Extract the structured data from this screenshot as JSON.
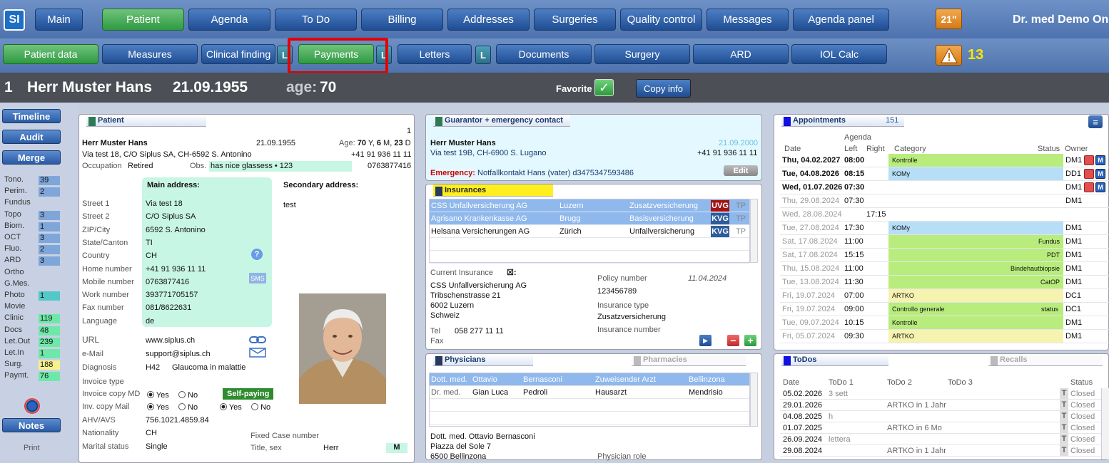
{
  "app": {
    "logo": "SI",
    "doctor": "Dr. med Demo One",
    "screen_size": "21\"",
    "alert_count": "13"
  },
  "nav": {
    "main": "Main",
    "patient": "Patient",
    "agenda": "Agenda",
    "todo": "To Do",
    "billing": "Billing",
    "addresses": "Addresses",
    "surgeries": "Surgeries",
    "quality": "Quality control",
    "messages": "Messages",
    "agenda_panel": "Agenda panel"
  },
  "subnav": {
    "patient_data": "Patient data",
    "measures": "Measures",
    "clinical": "Clinical finding",
    "l": "L",
    "payments": "Payments",
    "letters": "Letters",
    "documents": "Documents",
    "surgery": "Surgery",
    "ard": "ARD",
    "iol": "IOL Calc"
  },
  "header": {
    "index": "1",
    "name": "Herr Muster Hans",
    "dob": "21.09.1955",
    "age_label": "age:",
    "age": "70",
    "favorite": "Favorite",
    "copy_info": "Copy info"
  },
  "sidebar": {
    "timeline": "Timeline",
    "audit": "Audit",
    "merge": "Merge",
    "notes": "Notes",
    "print": "Print",
    "counts": [
      {
        "label": "Tono.",
        "value": "39",
        "color": "#7fa6d8"
      },
      {
        "label": "Perim.",
        "value": "2",
        "color": "#7fa6d8"
      },
      {
        "label": "Fundus",
        "value": "",
        "color": ""
      },
      {
        "label": "Topo",
        "value": "3",
        "color": "#7fa6d8"
      },
      {
        "label": "Biom.",
        "value": "1",
        "color": "#7fa6d8"
      },
      {
        "label": "OCT",
        "value": "3",
        "color": "#7fa6d8"
      },
      {
        "label": "Fluo.",
        "value": "2",
        "color": "#7fa6d8"
      },
      {
        "label": "ARD",
        "value": "3",
        "color": "#7fa6d8"
      },
      {
        "label": "Ortho",
        "value": "",
        "color": ""
      },
      {
        "label": "G.Mes.",
        "value": "",
        "color": ""
      },
      {
        "label": "Photo",
        "value": "1",
        "color": "#54c8c8"
      },
      {
        "label": "Movie",
        "value": "",
        "color": ""
      },
      {
        "label": "Clinic",
        "value": "119",
        "color": "#6ee8a8"
      },
      {
        "label": "Docs",
        "value": "48",
        "color": "#6ee8a8"
      },
      {
        "label": "Let.Out",
        "value": "239",
        "color": "#6ee8a8"
      },
      {
        "label": "Let.In",
        "value": "1",
        "color": "#6ee8a8"
      },
      {
        "label": "Surg.",
        "value": "188",
        "color": "#f6f28a"
      },
      {
        "label": "Paymt.",
        "value": "76",
        "color": "#6ee8a8"
      }
    ]
  },
  "patient": {
    "title": "Patient",
    "page": "1",
    "name": "Herr Muster Hans",
    "dob": "21.09.1955",
    "age_label": "Age:",
    "age_years": "70",
    "age_y": "Y,",
    "age_months": "6",
    "age_m": "M,",
    "age_days": "23",
    "age_d": "D",
    "address_line": "Via test 18, C/O Siplus SA, CH-6592 S. Antonino",
    "phone": "+41 91 936 11 11",
    "occupation_label": "Occupation",
    "occupation": "Retired",
    "obs_label": "Obs.",
    "obs": "has nice glassess • 123",
    "mobile": "0763877416",
    "main_address": "Main address:",
    "secondary_address": "Secondary address:",
    "secondary_value": "test",
    "fields": [
      {
        "label": "Street 1",
        "value": "Via test 18"
      },
      {
        "label": "Street 2",
        "value": "C/O Siplus SA"
      },
      {
        "label": "ZIP/City",
        "value": "6592     S. Antonino"
      },
      {
        "label": "State/Canton",
        "value": "TI"
      },
      {
        "label": "Country",
        "value": "CH"
      },
      {
        "label": "Home number",
        "value": "+41 91 936 11 11"
      },
      {
        "label": "Mobile number",
        "value": "0763877416"
      },
      {
        "label": "Work number",
        "value": "393771705157"
      },
      {
        "label": "Fax number",
        "value": "081/8622631"
      },
      {
        "label": "Language",
        "value": "de"
      }
    ],
    "sms": "SMS",
    "url_label": "URL",
    "url": "www.siplus.ch",
    "email_label": "e-Mail",
    "email": "support@siplus.ch",
    "diagnosis_label": "Diagnosis",
    "diagnosis_code": "H42",
    "diagnosis": "Glaucoma in malattie",
    "invoice_type": "Invoice type",
    "invoice_md": "Invoice copy MD",
    "inv_mail": "Inv. copy Mail",
    "yes": "Yes",
    "no": "No",
    "self_paying": "Self-paying",
    "ahv_label": "AHV/AVS",
    "ahv": "756.1021.4859.84",
    "nationality_label": "Nationality",
    "nationality": "CH",
    "marital_label": "Marital status",
    "marital": "Single",
    "fixed_case": "Fixed Case number",
    "title_sex_label": "Title, sex",
    "title_sex": "Herr",
    "sex_code": "M"
  },
  "guarantor": {
    "title": "Guarantor + emergency contact",
    "name": "Herr Muster Hans",
    "date": "21.09.2000",
    "address": "Via test 19B, CH-6900 S. Lugano",
    "phone": "+41 91 936 11 11",
    "emergency_label": "Emergency:",
    "emergency": "Notfallkontakt Hans (vater) d3475347593486",
    "edit": "Edit"
  },
  "insurances": {
    "title": "Insurances",
    "rows": [
      {
        "name": "CSS Unfallversicherung AG",
        "city": "Luzern",
        "type": "Zusatzversicherung",
        "code": "UVG",
        "tp": "TP",
        "selected": true,
        "code_color": "#a31414"
      },
      {
        "name": "Agrisano Krankenkasse AG",
        "city": "Brugg",
        "type": "Basisversicherung",
        "code": "KVG",
        "tp": "TP",
        "selected": true,
        "code_color": "#2e5c9a"
      },
      {
        "name": "Helsana Versicherungen AG",
        "city": "Zürich",
        "type": "Unfallversicherung",
        "code": "KVG",
        "tp": "TP",
        "selected": false,
        "code_color": "#2e5c9a"
      }
    ],
    "current_label": "Current Insurance",
    "current_name": "CSS Unfallversicherung AG",
    "current_street": "Tribschenstrasse 21",
    "current_city": "6002 Luzern",
    "current_country": "Schweiz",
    "tel_label": "Tel",
    "tel": "058 277 11 11",
    "fax_label": "Fax",
    "policy_label": "Policy number",
    "policy_date": "11.04.2024",
    "policy": "123456789",
    "ins_type_label": "Insurance type",
    "ins_type": "Zusatzversicherung",
    "ins_number_label": "Insurance number"
  },
  "physicians": {
    "title": "Physicians",
    "pharmacies": "Pharmacies",
    "rows": [
      {
        "title": "Dott. med.",
        "first": "Ottavio",
        "last": "Bernasconi",
        "role": "Zuweisender Arzt",
        "city": "Bellinzona",
        "selected": true
      },
      {
        "title": "Dr. med.",
        "first": "Gian Luca",
        "last": "Pedroli",
        "role": "Hausarzt",
        "city": "Mendrisio",
        "selected": false
      }
    ],
    "detail_name": "Dott. med. Ottavio Bernasconi",
    "detail_street": "Piazza del Sole 7",
    "detail_city": "6500 Bellinzona",
    "role_label": "Physician role"
  },
  "appointments": {
    "title": "Appointments",
    "count": "151",
    "headers": {
      "agenda": "Agenda",
      "date": "Date",
      "left": "Left",
      "right": "Right",
      "category": "Category",
      "status": "Status",
      "owner": "Owner"
    },
    "rows": [
      {
        "date": "Thu, 04.02.2027",
        "left": "08:00",
        "right": "",
        "category": "Kontrolle",
        "cat_align": "left",
        "cat_color": "#b8ec7c",
        "status": "",
        "owner": "DM1",
        "future": true,
        "icons": true
      },
      {
        "date": "Tue, 04.08.2026",
        "left": "08:15",
        "right": "",
        "category": "KOMy",
        "cat_align": "left",
        "cat_color": "#b6def6",
        "status": "",
        "owner": "DD1",
        "future": true,
        "icons": true
      },
      {
        "date": "Wed, 01.07.2026",
        "left": "07:30",
        "right": "",
        "category": "",
        "cat_align": "left",
        "cat_color": "",
        "status": "",
        "owner": "DM1",
        "future": true,
        "icons": true
      },
      {
        "date": "Thu, 29.08.2024",
        "left": "07:30",
        "right": "",
        "category": "",
        "cat_align": "left",
        "cat_color": "",
        "status": "",
        "owner": "DM1",
        "future": false,
        "icons": false
      },
      {
        "date": "Wed, 28.08.2024",
        "left": "",
        "right": "17:15",
        "category": "",
        "cat_align": "left",
        "cat_color": "",
        "status": "",
        "owner": "",
        "future": false,
        "icons": false
      },
      {
        "date": "Tue, 27.08.2024",
        "left": "17:30",
        "right": "",
        "category": "KOMy",
        "cat_align": "left",
        "cat_color": "#b6def6",
        "status": "",
        "owner": "DM1",
        "future": false,
        "icons": false
      },
      {
        "date": "Sat, 17.08.2024",
        "left": "11:00",
        "right": "",
        "category": "Fundus",
        "cat_align": "right",
        "cat_color": "#b8ec7c",
        "status": "",
        "owner": "DM1",
        "future": false,
        "icons": false
      },
      {
        "date": "Sat, 17.08.2024",
        "left": "15:15",
        "right": "",
        "category": "PDT",
        "cat_align": "right",
        "cat_color": "#b8ec7c",
        "status": "",
        "owner": "DM1",
        "future": false,
        "icons": false
      },
      {
        "date": "Thu, 15.08.2024",
        "left": "11:00",
        "right": "",
        "category": "Bindehautbiopsie",
        "cat_align": "right",
        "cat_color": "#b8ec7c",
        "status": "",
        "owner": "DM1",
        "future": false,
        "icons": false
      },
      {
        "date": "Tue, 13.08.2024",
        "left": "11:30",
        "right": "",
        "category": "CatOP",
        "cat_align": "right",
        "cat_color": "#b8ec7c",
        "status": "",
        "owner": "DM1",
        "future": false,
        "icons": false
      },
      {
        "date": "Fri, 19.07.2024",
        "left": "07:00",
        "right": "",
        "category": "ARTKO",
        "cat_align": "left",
        "cat_color": "#f6f2b0",
        "status": "",
        "owner": "DC1",
        "future": false,
        "icons": false
      },
      {
        "date": "Fri, 19.07.2024",
        "left": "09:00",
        "right": "",
        "category": "Controllo generale",
        "cat_align": "left",
        "cat_color": "#b8ec7c",
        "status": "status",
        "owner": "DC1",
        "future": false,
        "icons": false
      },
      {
        "date": "Tue, 09.07.2024",
        "left": "10:15",
        "right": "",
        "category": "Kontrolle",
        "cat_align": "left",
        "cat_color": "#b8ec7c",
        "status": "",
        "owner": "DM1",
        "future": false,
        "icons": false
      },
      {
        "date": "Fri, 05.07.2024",
        "left": "09:30",
        "right": "",
        "category": "ARTKO",
        "cat_align": "left",
        "cat_color": "#f6f2b0",
        "status": "",
        "owner": "DM1",
        "future": false,
        "icons": false
      }
    ]
  },
  "todos": {
    "title": "ToDos",
    "recalls": "Recalls",
    "headers": {
      "date": "Date",
      "todo1": "ToDo 1",
      "todo2": "ToDo 2",
      "todo3": "ToDo 3",
      "status": "Status"
    },
    "rows": [
      {
        "date": "05.02.2026",
        "todo1": "3 sett",
        "todo2": "",
        "todo3": "",
        "t": "T",
        "status": "Closed"
      },
      {
        "date": "29.01.2026",
        "todo1": "",
        "todo2": "ARTKO in 1 Jahr",
        "todo3": "",
        "t": "T",
        "status": "Closed"
      },
      {
        "date": "04.08.2025",
        "todo1": "h",
        "todo2": "",
        "todo3": "",
        "t": "T",
        "status": "Closed"
      },
      {
        "date": "01.07.2025",
        "todo1": "",
        "todo2": "ARTKO in 6 Mo",
        "todo3": "",
        "t": "T",
        "status": "Closed"
      },
      {
        "date": "26.09.2024",
        "todo1": "lettera",
        "todo2": "",
        "todo3": "",
        "t": "T",
        "status": "Closed"
      },
      {
        "date": "29.08.2024",
        "todo1": "",
        "todo2": "ARTKO in 1 Jahr",
        "todo3": "",
        "t": "T",
        "status": "Closed"
      }
    ]
  }
}
